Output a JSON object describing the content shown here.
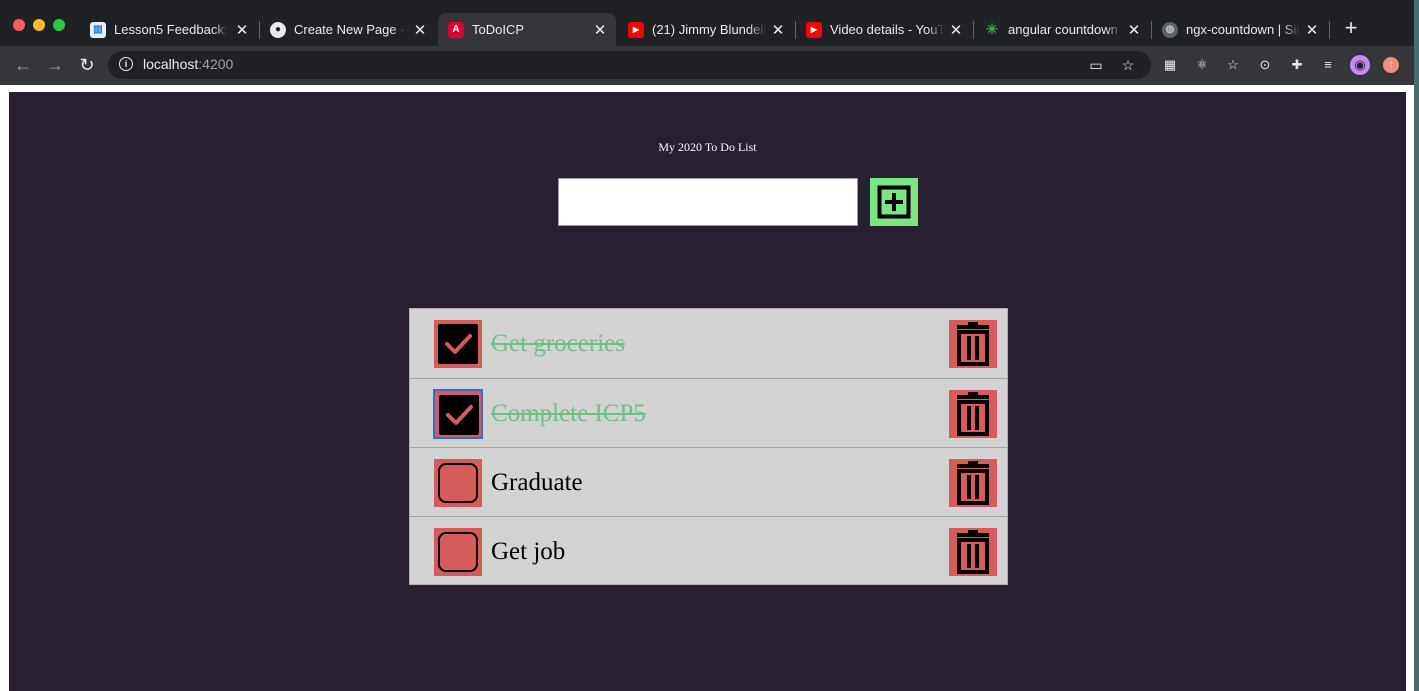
{
  "browser": {
    "tabs": [
      {
        "title": "Lesson5 Feedback: V",
        "icon": "chart-favicon-icon"
      },
      {
        "title": "Create New Page · J",
        "icon": "github-icon"
      },
      {
        "title": "ToDoICP",
        "icon": "angular-icon",
        "active": true
      },
      {
        "title": "(21) Jimmy Blundell",
        "icon": "youtube-icon"
      },
      {
        "title": "Video details - YouT",
        "icon": "youtube-icon"
      },
      {
        "title": "angular countdown t",
        "icon": "search-favicon-icon"
      },
      {
        "title": "ngx-countdown | Sir",
        "icon": "globe-icon"
      }
    ],
    "address": {
      "host": "localhost",
      "port": ":4200"
    }
  },
  "app": {
    "title": "My 2020 To Do List",
    "new_todo_value": "",
    "colors": {
      "background": "#281f31",
      "add_button": "#7ce582",
      "accent_red": "#d65c5c",
      "done_text": "#6fbf8a",
      "list_bg": "#d3d3d3"
    },
    "todos": [
      {
        "label": "Get groceries",
        "completed": true
      },
      {
        "label": "Complete ICP5",
        "completed": true
      },
      {
        "label": "Graduate",
        "completed": false
      },
      {
        "label": "Get job",
        "completed": false
      }
    ]
  }
}
